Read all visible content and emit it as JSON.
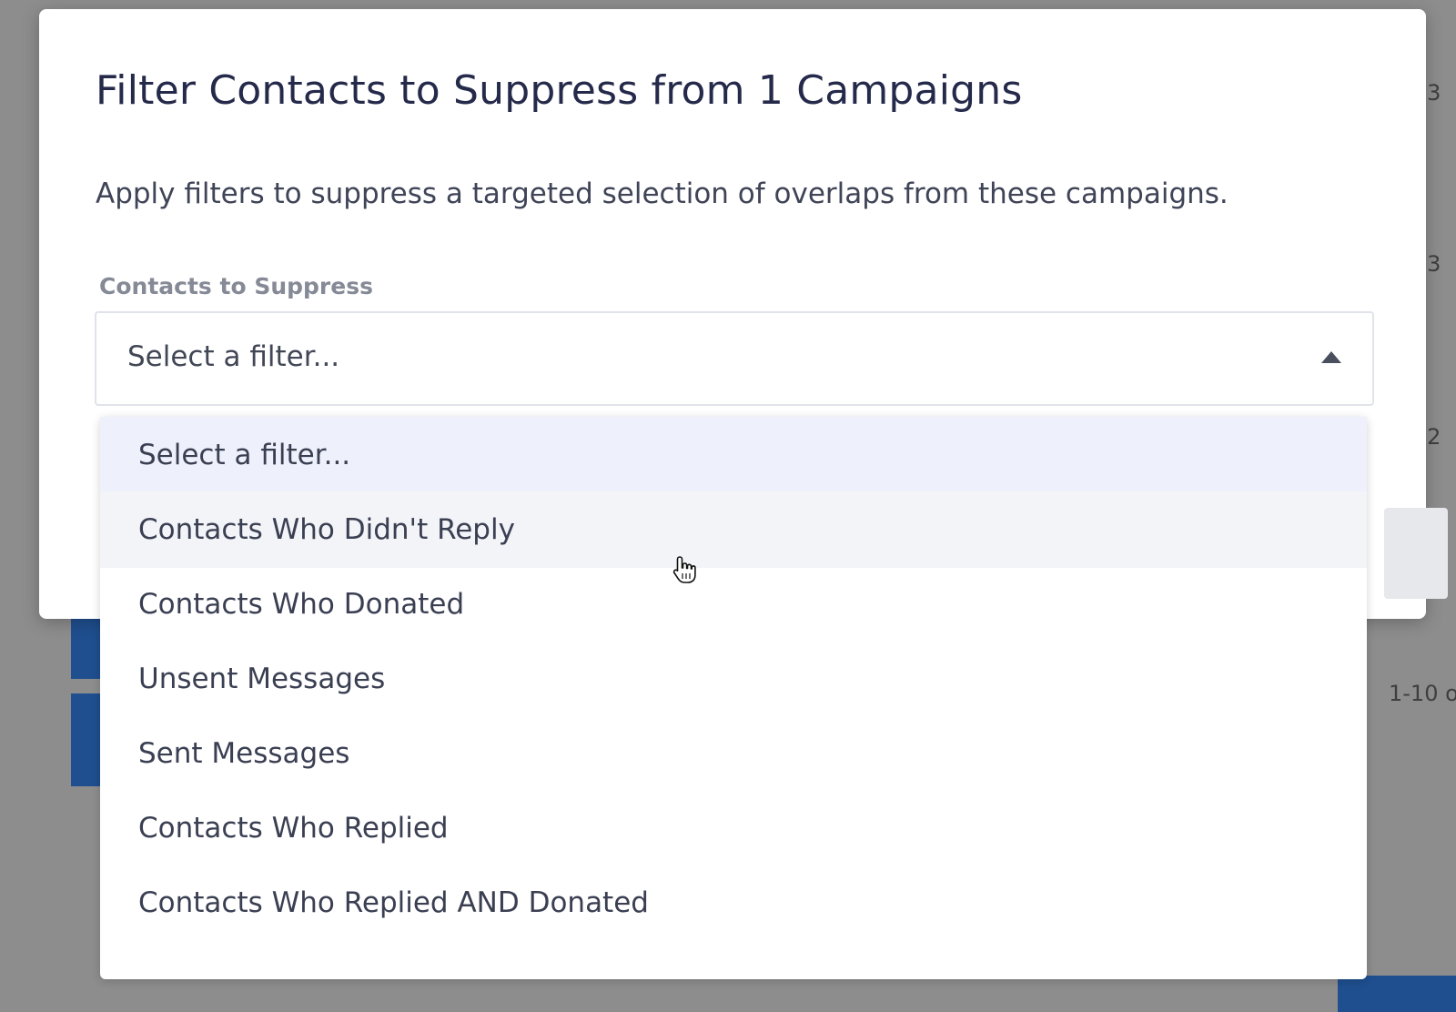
{
  "background": {
    "pager_text": "1-10 o",
    "clipped_times": [
      ":3",
      ":3",
      ":2"
    ]
  },
  "modal": {
    "title": "Filter Contacts to Suppress from 1 Campaigns",
    "description": "Apply filters to suppress a targeted selection of overlaps from these campaigns.",
    "field_label": "Contacts to Suppress",
    "select": {
      "value": "Select a filter...",
      "expanded": true
    }
  },
  "dropdown": {
    "options": [
      {
        "label": "Select a filter...",
        "state": "selected"
      },
      {
        "label": "Contacts Who Didn't Reply",
        "state": "hovered"
      },
      {
        "label": "Contacts Who Donated",
        "state": ""
      },
      {
        "label": "Unsent Messages",
        "state": ""
      },
      {
        "label": "Sent Messages",
        "state": ""
      },
      {
        "label": "Contacts Who Replied",
        "state": ""
      },
      {
        "label": "Contacts Who Replied AND Donated",
        "state": ""
      }
    ]
  },
  "colors": {
    "accent": "#1f4f8f",
    "title": "#252a4a",
    "selected_bg": "#eef1fb"
  }
}
